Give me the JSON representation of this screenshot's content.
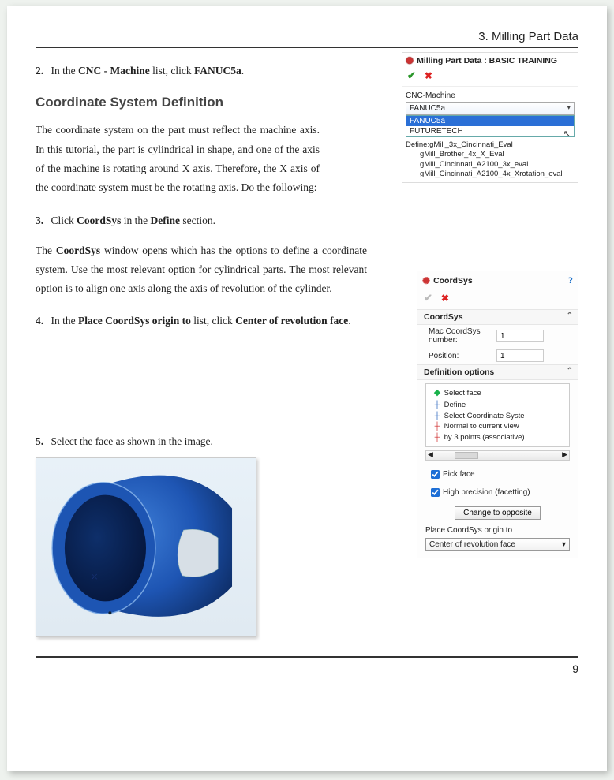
{
  "header": {
    "chapter": "3. Milling Part Data"
  },
  "page_number": "9",
  "step2": {
    "num": "2.",
    "pre": "In the ",
    "b1": "CNC - Machine",
    "mid": " list, click ",
    "b2": "FANUC5a",
    "post": "."
  },
  "heading": "Coordinate System Definition",
  "intro": "The coordinate system on the part must reflect the machine axis. In this tutorial, the part is cylindrical in shape, and one of the axis of the machine is rotating around X axis. Therefore, the X axis of the coordinate system must be the rotating axis. Do the following:",
  "step3": {
    "num": "3.",
    "pre": "Click ",
    "b1": "CoordSys",
    "mid": " in the ",
    "b2": "Define",
    "post": " section."
  },
  "para2a": "The ",
  "para2b": "CoordSys",
  "para2c": " window opens which has the options to define a coordinate system. Use the most relevant option for cylindrical parts. The most relevant option is to align one axis along the axis of revolution of the cylinder.",
  "step4": {
    "num": "4.",
    "pre": "In the ",
    "b1": "Place CoordSys origin to",
    "mid": " list, click ",
    "b2": "Center of revolution face",
    "post": "."
  },
  "step5": {
    "num": "5.",
    "pre": "Select the face as shown in the image."
  },
  "panel1": {
    "title": "Milling Part Data : BASIC TRAINING",
    "group_label": "CNC-Machine",
    "selected": "FANUC5a",
    "options": [
      "FANUC5a",
      "FUTURETECH"
    ],
    "define_label": "Define:",
    "define_items": [
      "gMill_3x_Cincinnati_Eval",
      "gMill_Brother_4x_X_Eval",
      "gMill_Cincinnati_A2100_3x_eval",
      "gMill_Cincinnati_A2100_4x_Xrotation_eval"
    ]
  },
  "panel2": {
    "title": "CoordSys",
    "sec1": "CoordSys",
    "mac_label": "Mac CoordSys number:",
    "mac_value": "1",
    "pos_label": "Position:",
    "pos_value": "1",
    "sec2": "Definition options",
    "tree": [
      "Select face",
      "Define",
      "Select Coordinate Syste",
      "Normal to current view",
      "by 3 points (associative)"
    ],
    "cb1": "Pick face",
    "cb2": "High precision (facetting)",
    "btn": "Change to opposite",
    "place_label": "Place CoordSys origin to",
    "place_value": "Center of revolution face"
  }
}
